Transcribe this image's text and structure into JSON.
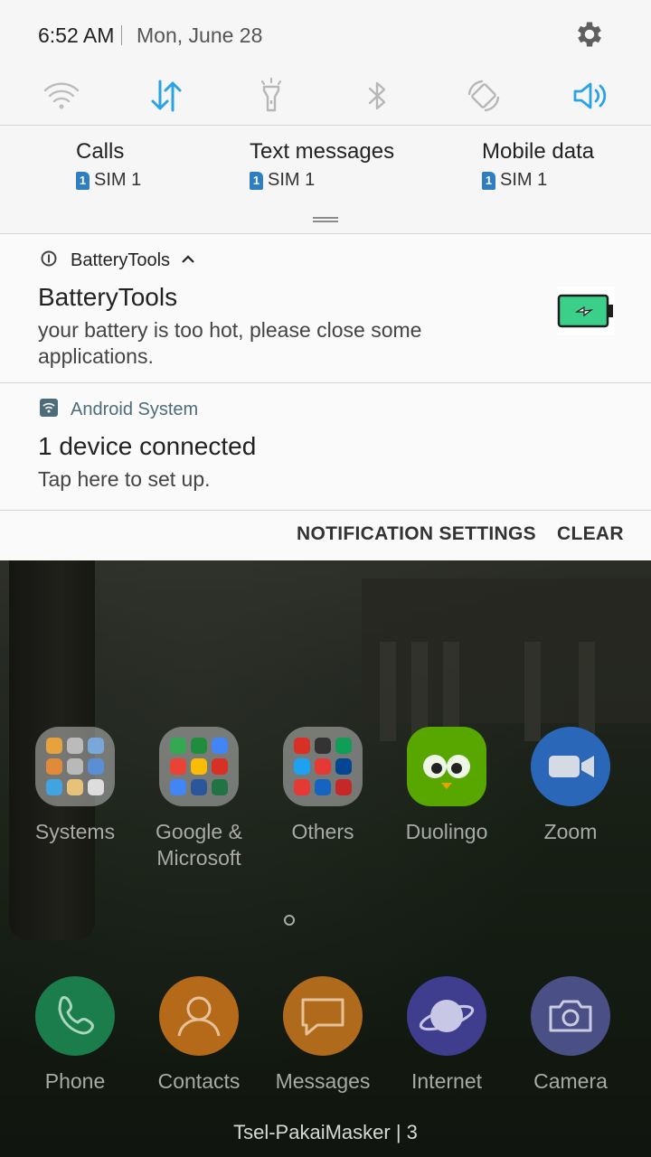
{
  "status": {
    "time": "6:52 AM",
    "date": "Mon, June 28"
  },
  "quick_settings": [
    {
      "name": "wifi-icon",
      "active": false
    },
    {
      "name": "mobile-data-icon",
      "active": true
    },
    {
      "name": "flashlight-icon",
      "active": false
    },
    {
      "name": "bluetooth-icon",
      "active": false
    },
    {
      "name": "auto-rotate-icon",
      "active": false
    },
    {
      "name": "sound-icon",
      "active": true
    }
  ],
  "sim": [
    {
      "title": "Calls",
      "badge": "1",
      "sim": "SIM 1"
    },
    {
      "title": "Text messages",
      "badge": "1",
      "sim": "SIM 1"
    },
    {
      "title": "Mobile data",
      "badge": "1",
      "sim": "SIM 1"
    }
  ],
  "notifications": {
    "battery": {
      "app_name": "BatteryTools",
      "title": "BatteryTools",
      "body": "your battery is too hot, please close some applications."
    },
    "system": {
      "app_name": "Android System",
      "title": "1 device connected",
      "body": "Tap here to set up."
    }
  },
  "actions": {
    "settings": "NOTIFICATION SETTINGS",
    "clear": "CLEAR"
  },
  "home": {
    "apps": [
      {
        "label": "Systems"
      },
      {
        "label": "Google &\nMicrosoft"
      },
      {
        "label": "Others"
      },
      {
        "label": "Duolingo"
      },
      {
        "label": "Zoom"
      }
    ],
    "dock": [
      {
        "label": "Phone"
      },
      {
        "label": "Contacts"
      },
      {
        "label": "Messages"
      },
      {
        "label": "Internet"
      },
      {
        "label": "Camera"
      }
    ],
    "carrier": "Tsel-PakaiMasker | 3"
  },
  "colors": {
    "accent": "#2aa3e6",
    "inactive": "#b7b7b7",
    "sim_badge": "#2f7ec2"
  }
}
